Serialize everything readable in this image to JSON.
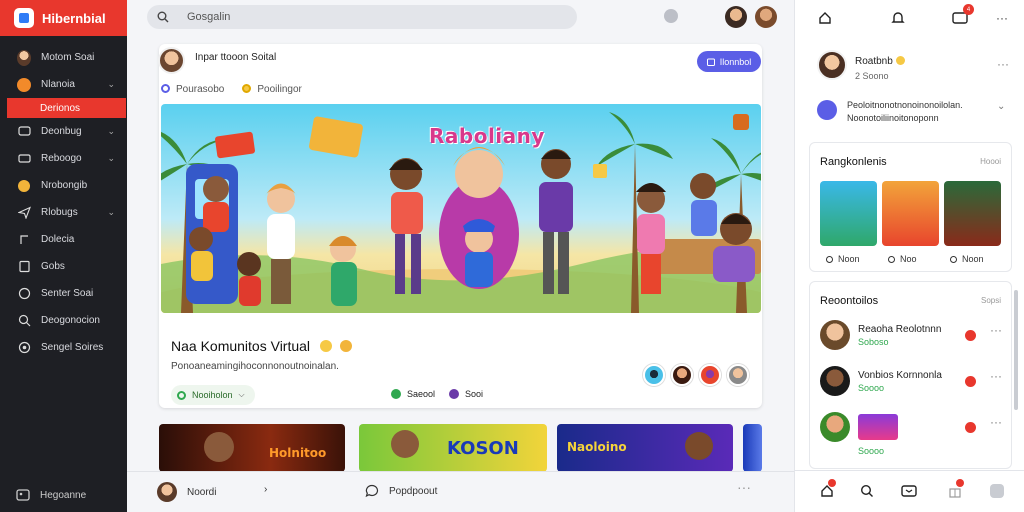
{
  "app": {
    "name": "Hibernbial"
  },
  "sidebar": {
    "items": [
      {
        "label": "Motom Soai",
        "icon": "avatar-icon",
        "chevron": false,
        "active": false
      },
      {
        "label": "Nlanoia",
        "icon": "circle-badge-icon",
        "chevron": true,
        "active": false
      },
      {
        "label": "Derionos",
        "icon": "",
        "chevron": false,
        "active": true
      },
      {
        "label": "Deonbug",
        "icon": "chat-icon",
        "chevron": true,
        "active": false
      },
      {
        "label": "Reboogo",
        "icon": "tv-icon",
        "chevron": true,
        "active": false
      },
      {
        "label": "Nrobongib",
        "icon": "people-icon",
        "chevron": false,
        "active": false
      },
      {
        "label": "Rlobugs",
        "icon": "send-icon",
        "chevron": true,
        "active": false
      },
      {
        "label": "Dolecia",
        "icon": "note-icon",
        "chevron": false,
        "active": false
      },
      {
        "label": "Gobs",
        "icon": "doc-icon",
        "chevron": false,
        "active": false
      },
      {
        "label": "Senter Soai",
        "icon": "compass-icon",
        "chevron": false,
        "active": false
      },
      {
        "label": "Deogonocion",
        "icon": "search-icon",
        "chevron": false,
        "active": false
      },
      {
        "label": "Sengel Soires",
        "icon": "settings-icon",
        "chevron": false,
        "active": false
      }
    ],
    "footer_label": "Hegoanne"
  },
  "search": {
    "value": "Gosgalin"
  },
  "post": {
    "author": "Inpar ttooon Soital",
    "join_label": "Ilonnbol",
    "meta": [
      "Pourasobo",
      "Pooilingor"
    ],
    "hero_title": "Raboliany",
    "title": "Naa Komunitos Virtual",
    "description": "Ponoaneamingihoconnonoutnoinalan.",
    "chip_label": "Nooiholon",
    "stats": [
      "Saeool",
      "Sooi"
    ]
  },
  "thumbs": [
    "Holnitoo",
    "KOSON",
    "Naoloino"
  ],
  "bottombar": {
    "user_label": "Noordi",
    "reply_label": "Popdpoout"
  },
  "right": {
    "notification_count": "4",
    "profile": {
      "name": "Roatbnb",
      "sub": "2 Soono"
    },
    "notice": {
      "line1": "Peoloitnonotnonoinonoilolan.",
      "line2": "Noonotoiliinoitonoponn"
    },
    "games_panel": {
      "title": "Rangkonlenis",
      "link": "Hoooi",
      "games": [
        "Noon",
        "Noo",
        "Noon"
      ]
    },
    "friends_panel": {
      "title": "Reoontoilos",
      "link": "Sopsi",
      "friends": [
        {
          "name": "Reaoha Reolotnnn",
          "sub": "Soboso"
        },
        {
          "name": "Vonbios Kornnonla",
          "sub": "Soooo"
        },
        {
          "name": "",
          "sub": "Soooo"
        }
      ]
    }
  },
  "colors": {
    "accent_red": "#e8372d",
    "accent_purple": "#5b5ee6",
    "online_green": "#2fa84f"
  }
}
